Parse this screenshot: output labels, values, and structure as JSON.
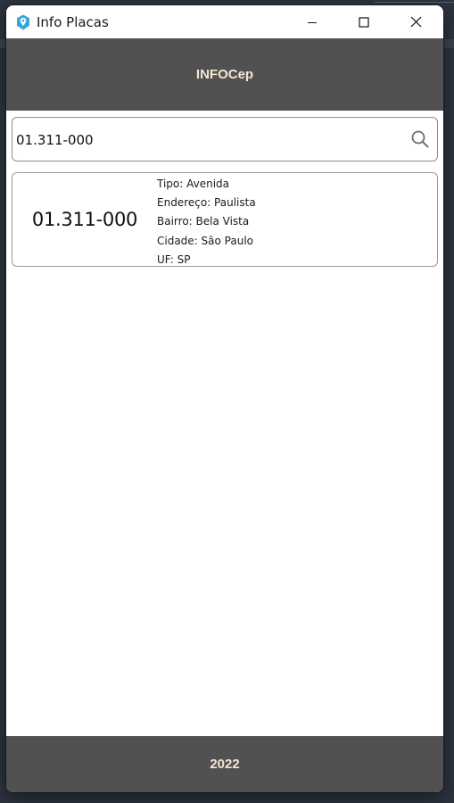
{
  "window": {
    "title": "Info Placas",
    "icon": "location-pin-icon"
  },
  "header": {
    "title": "INFOCep"
  },
  "search": {
    "value": "01.311-000",
    "icon": "search-icon"
  },
  "result": {
    "cep": "01.311-000",
    "details": [
      "Tipo: Avenida",
      "Endereço: Paulista",
      "Bairro: Bela Vista",
      "Cidade: São Paulo",
      "UF: SP"
    ]
  },
  "footer": {
    "text": "2022"
  },
  "colors": {
    "bar": "#515151",
    "bar_text": "#f6e6d2",
    "app_icon": "#3aa6d8"
  }
}
